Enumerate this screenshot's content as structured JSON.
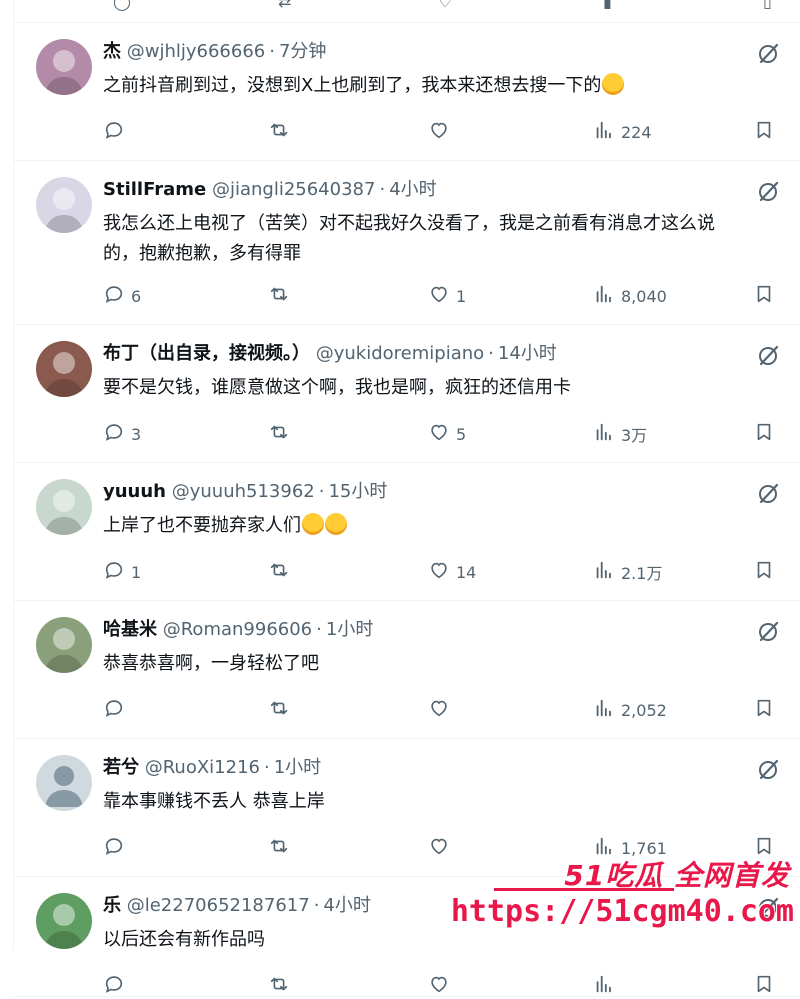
{
  "posts": [
    {
      "name": "杰",
      "handle": "@wjhljy666666",
      "time": "7分钟",
      "text": "之前抖音刷到过，没想到X上也刷到了，我本来还想去搜一下的",
      "emoji": "face-savoring-food-emoji",
      "replies": "",
      "reposts": "",
      "likes": "",
      "views": "224",
      "avatar_color": "#b38aa8"
    },
    {
      "name": "StillFrame",
      "handle": "@jiangli25640387",
      "time": "4小时",
      "text": "我怎么还上电视了（苦笑）对不起我好久没看了，我是之前看有消息才这么说\n的，抱歉抱歉，多有得罪",
      "emoji": "",
      "replies": "6",
      "reposts": "",
      "likes": "1",
      "views": "8,040",
      "avatar_color": "#d9d6e6"
    },
    {
      "name": "布丁（出自录，接视频。）",
      "handle": "@yukidoremipiano",
      "time": "14小时",
      "text": "要不是欠钱，谁愿意做这个啊，我也是啊，疯狂的还信用卡",
      "emoji": "",
      "replies": "3",
      "reposts": "",
      "likes": "5",
      "views": "3万",
      "avatar_color": "#8a5a4e"
    },
    {
      "name": "yuuuh",
      "handle": "@yuuuh513962",
      "time": "15小时",
      "text": "上岸了也不要抛弃家人们",
      "emoji": "loudly-crying-face-emoji",
      "replies": "1",
      "reposts": "",
      "likes": "14",
      "views": "2.1万",
      "avatar_color": "#c8d8cf"
    },
    {
      "name": "哈基米",
      "handle": "@Roman996606",
      "time": "1小时",
      "text": "恭喜恭喜啊，一身轻松了吧",
      "emoji": "",
      "replies": "",
      "reposts": "",
      "likes": "",
      "views": "2,052",
      "avatar_color": "#8aa07a"
    },
    {
      "name": "若兮",
      "handle": "@RuoXi1216",
      "time": "1小时",
      "text": "靠本事赚钱不丢人 恭喜上岸",
      "emoji": "",
      "replies": "",
      "reposts": "",
      "likes": "",
      "views": "1,761",
      "avatar_color": "#cfd9de"
    },
    {
      "name": "乐",
      "handle": "@le2270652187617",
      "time": "4小时",
      "text": "以后还会有新作品吗",
      "emoji": "",
      "replies": "",
      "reposts": "",
      "likes": "",
      "views": "",
      "avatar_color": "#5f9e62"
    }
  ],
  "separator": "·",
  "watermark": {
    "top": "51吃瓜 全网首发",
    "url": "https://51cgm40.com"
  },
  "colors": {
    "text": "#0f1419",
    "secondary": "#536471",
    "border": "#eff3f4",
    "watermark": "#e8184a"
  }
}
